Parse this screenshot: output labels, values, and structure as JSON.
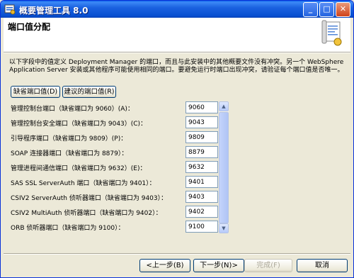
{
  "window": {
    "title": "概要管理工具 8.0",
    "minimize_glyph": "_",
    "maximize_glyph": "□",
    "close_glyph": "✕"
  },
  "header": {
    "page_title": "端口值分配"
  },
  "description": "以下字段中的值定义 Deployment Manager 的端口，而且与此安装中的其他概要文件没有冲突。另一个 WebSphere Application Server 安装或其他程序可能使用相同的端口。要避免运行时端口出现冲突，请验证每个端口值是否唯一。",
  "buttons": {
    "default_ports": "缺省端口值(D)",
    "suggested_ports": "建议的端口值(R)"
  },
  "ports": [
    {
      "label": "管理控制台端口（缺省端口为 9060）(A)：",
      "value": "9060"
    },
    {
      "label": "管理控制台安全端口（缺省端口为 9043）(C)：",
      "value": "9043"
    },
    {
      "label": "引导程序端口（缺省端口为 9809）(P)：",
      "value": "9809"
    },
    {
      "label": "SOAP 连接器端口（缺省端口为 8879）：",
      "value": "8879"
    },
    {
      "label": "管理进程间通信端口（缺省端口为 9632）(E)：",
      "value": "9632"
    },
    {
      "label": "SAS SSL ServerAuth 端口（缺省端口为 9401）：",
      "value": "9401"
    },
    {
      "label": "CSIV2 ServerAuth 侦听器端口（缺省端口为 9403）：",
      "value": "9403"
    },
    {
      "label": "CSIV2 MultiAuth 侦听器端口（缺省端口为 9402）：",
      "value": "9402"
    },
    {
      "label": "ORB 侦听器端口（缺省端口为 9100）：",
      "value": "9100"
    }
  ],
  "scrollbar": {
    "up_glyph": "▲",
    "down_glyph": "▼"
  },
  "footer": {
    "back": "<上一步(B)",
    "next": "下一步(N)>",
    "finish": "完成(F)",
    "cancel": "取消"
  },
  "colors": {
    "titlebar": "#0a5fe8",
    "dialog_bg": "#ece9d8",
    "field_border": "#7f9db9"
  }
}
